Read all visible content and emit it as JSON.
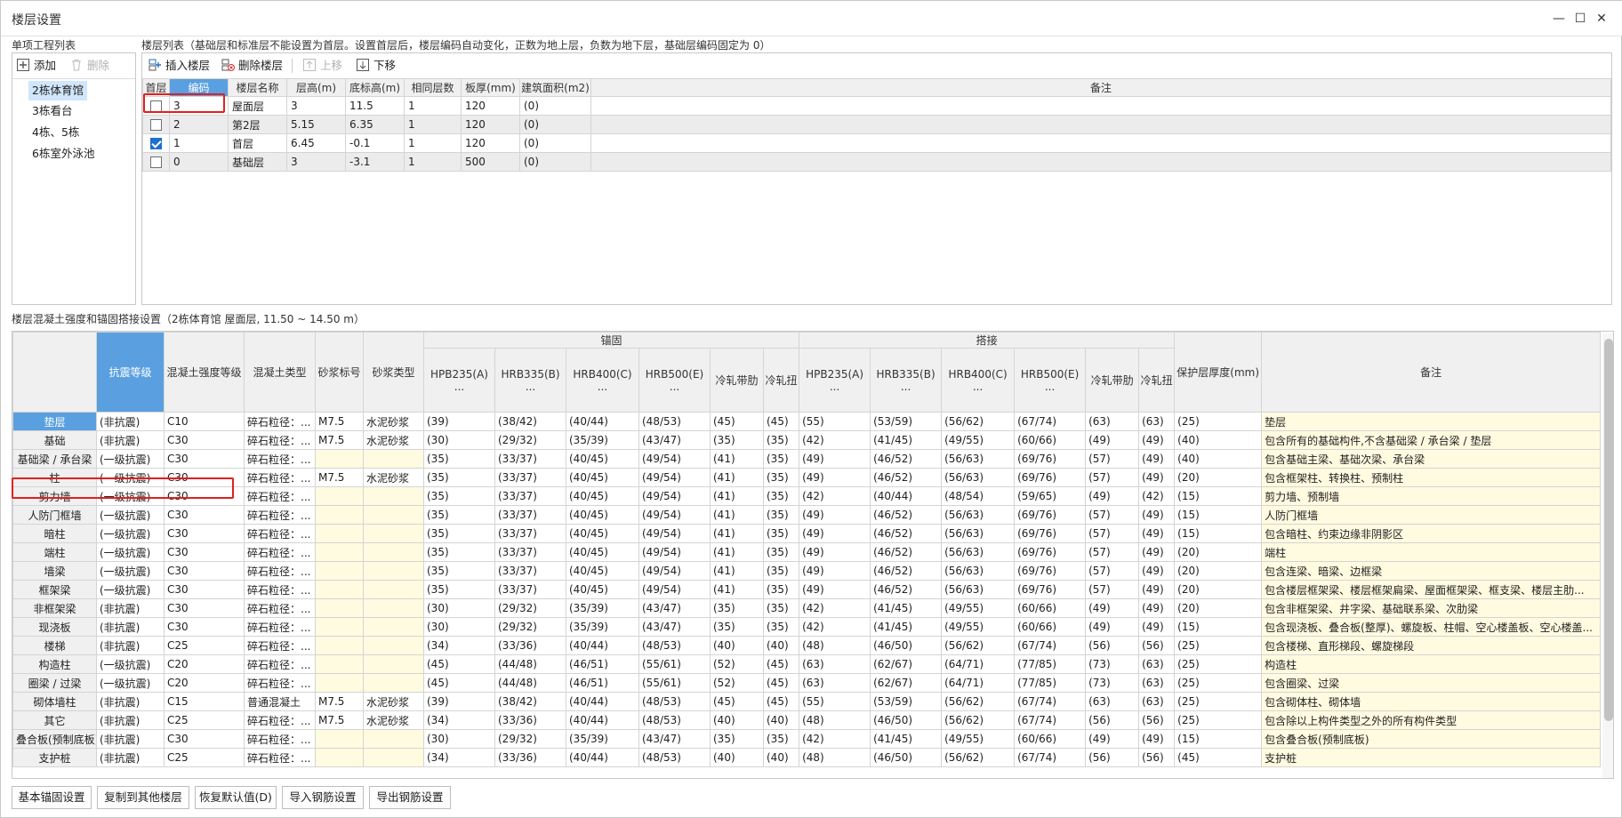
{
  "window": {
    "title": "楼层设置",
    "min": "—",
    "max": "☐",
    "close": "✕"
  },
  "project_list": {
    "label": "单项工程列表",
    "add": "添加",
    "delete": "删除",
    "items": [
      "2栋体育馆",
      "3栋看台",
      "4栋、5栋",
      "6栋室外泳池"
    ],
    "selected": 0
  },
  "floor_list": {
    "label": "楼层列表（基础层和标准层不能设置为首层。设置首层后，楼层编码自动变化，正数为地上层，负数为地下层，基础层编码固定为 0）",
    "toolbar": {
      "insert": "插入楼层",
      "delete": "删除楼层",
      "up": "上移",
      "down": "下移"
    },
    "columns": [
      "首层",
      "编码",
      "楼层名称",
      "层高(m)",
      "底标高(m)",
      "相同层数",
      "板厚(mm)",
      "建筑面积(m2)",
      "备注"
    ],
    "rows": [
      {
        "first": false,
        "code": "3",
        "name": "屋面层",
        "height": "3",
        "bottom": "11.5",
        "same": "1",
        "thick": "120",
        "area": "(0)",
        "note": ""
      },
      {
        "first": false,
        "code": "2",
        "name": "第2层",
        "height": "5.15",
        "bottom": "6.35",
        "same": "1",
        "thick": "120",
        "area": "(0)",
        "note": ""
      },
      {
        "first": true,
        "code": "1",
        "name": "首层",
        "height": "6.45",
        "bottom": "-0.1",
        "same": "1",
        "thick": "120",
        "area": "(0)",
        "note": ""
      },
      {
        "first": false,
        "code": "0",
        "name": "基础层",
        "height": "3",
        "bottom": "-3.1",
        "same": "1",
        "thick": "500",
        "area": "(0)",
        "note": ""
      }
    ]
  },
  "settings": {
    "label": "楼层混凝土强度和锚固搭接设置（2栋体育馆  屋面层, 11.50 ~ 14.50 m）",
    "group_anchor": "锚固",
    "group_lap": "搭接",
    "columns": [
      "抗震等级",
      "混凝土强度等级",
      "混凝土类型",
      "砂浆标号",
      "砂浆类型",
      "HPB235(A)\n...",
      "HRB335(B)\n...",
      "HRB400(C)\n...",
      "HRB500(E)\n...",
      "冷轧带肋",
      "冷轧扭",
      "HPB235(A)\n...",
      "HRB335(B)\n...",
      "HRB400(C)\n...",
      "HRB500(E)\n...",
      "冷轧带肋",
      "冷轧扭",
      "保护层厚度(mm)",
      "备注"
    ],
    "rows": [
      [
        "垫层",
        "(非抗震)",
        "C10",
        "碎石粒径：...",
        "M7.5",
        "水泥砂浆",
        "(39)",
        "(38/42)",
        "(40/44)",
        "(48/53)",
        "(45)",
        "(45)",
        "(55)",
        "(53/59)",
        "(56/62)",
        "(67/74)",
        "(63)",
        "(63)",
        "(25)",
        "垫层"
      ],
      [
        "基础",
        "(非抗震)",
        "C30",
        "碎石粒径：...",
        "M7.5",
        "水泥砂浆",
        "(30)",
        "(29/32)",
        "(35/39)",
        "(43/47)",
        "(35)",
        "(35)",
        "(42)",
        "(41/45)",
        "(49/55)",
        "(60/66)",
        "(49)",
        "(49)",
        "(40)",
        "包含所有的基础构件,不含基础梁 / 承台梁 / 垫层"
      ],
      [
        "基础梁 / 承台梁",
        "(一级抗震)",
        "C30",
        "碎石粒径：...",
        "",
        "",
        "(35)",
        "(33/37)",
        "(40/45)",
        "(49/54)",
        "(41)",
        "(35)",
        "(49)",
        "(46/52)",
        "(56/63)",
        "(69/76)",
        "(57)",
        "(49)",
        "(40)",
        "包含基础主梁、基础次梁、承台梁"
      ],
      [
        "柱",
        "(一级抗震)",
        "C30",
        "碎石粒径：...",
        "M7.5",
        "水泥砂浆",
        "(35)",
        "(33/37)",
        "(40/45)",
        "(49/54)",
        "(41)",
        "(35)",
        "(49)",
        "(46/52)",
        "(56/63)",
        "(69/76)",
        "(57)",
        "(49)",
        "(20)",
        "包含框架柱、转换柱、预制柱"
      ],
      [
        "剪力墙",
        "(一级抗震)",
        "C30",
        "碎石粒径：...",
        "",
        "",
        "(35)",
        "(33/37)",
        "(40/45)",
        "(49/54)",
        "(41)",
        "(35)",
        "(42)",
        "(40/44)",
        "(48/54)",
        "(59/65)",
        "(49)",
        "(42)",
        "(15)",
        "剪力墙、预制墙"
      ],
      [
        "人防门框墙",
        "(一级抗震)",
        "C30",
        "碎石粒径：...",
        "",
        "",
        "(35)",
        "(33/37)",
        "(40/45)",
        "(49/54)",
        "(41)",
        "(35)",
        "(49)",
        "(46/52)",
        "(56/63)",
        "(69/76)",
        "(57)",
        "(49)",
        "(15)",
        "人防门框墙"
      ],
      [
        "暗柱",
        "(一级抗震)",
        "C30",
        "碎石粒径：...",
        "",
        "",
        "(35)",
        "(33/37)",
        "(40/45)",
        "(49/54)",
        "(41)",
        "(35)",
        "(49)",
        "(46/52)",
        "(56/63)",
        "(69/76)",
        "(57)",
        "(49)",
        "(15)",
        "包含暗柱、约束边缘非阴影区"
      ],
      [
        "端柱",
        "(一级抗震)",
        "C30",
        "碎石粒径：...",
        "",
        "",
        "(35)",
        "(33/37)",
        "(40/45)",
        "(49/54)",
        "(41)",
        "(35)",
        "(49)",
        "(46/52)",
        "(56/63)",
        "(69/76)",
        "(57)",
        "(49)",
        "(20)",
        "端柱"
      ],
      [
        "墙梁",
        "(一级抗震)",
        "C30",
        "碎石粒径：...",
        "",
        "",
        "(35)",
        "(33/37)",
        "(40/45)",
        "(49/54)",
        "(41)",
        "(35)",
        "(49)",
        "(46/52)",
        "(56/63)",
        "(69/76)",
        "(57)",
        "(49)",
        "(20)",
        "包含连梁、暗梁、边框梁"
      ],
      [
        "框架梁",
        "(一级抗震)",
        "C30",
        "碎石粒径：...",
        "",
        "",
        "(35)",
        "(33/37)",
        "(40/45)",
        "(49/54)",
        "(41)",
        "(35)",
        "(49)",
        "(46/52)",
        "(56/63)",
        "(69/76)",
        "(57)",
        "(49)",
        "(20)",
        "包含楼层框架梁、楼层框架扁梁、屋面框架梁、框支梁、楼层主肋..."
      ],
      [
        "非框架梁",
        "(非抗震)",
        "C30",
        "碎石粒径：...",
        "",
        "",
        "(30)",
        "(29/32)",
        "(35/39)",
        "(43/47)",
        "(35)",
        "(35)",
        "(42)",
        "(41/45)",
        "(49/55)",
        "(60/66)",
        "(49)",
        "(49)",
        "(20)",
        "包含非框架梁、井字梁、基础联系梁、次肋梁"
      ],
      [
        "现浇板",
        "(非抗震)",
        "C30",
        "碎石粒径：...",
        "",
        "",
        "(30)",
        "(29/32)",
        "(35/39)",
        "(43/47)",
        "(35)",
        "(35)",
        "(42)",
        "(41/45)",
        "(49/55)",
        "(60/66)",
        "(49)",
        "(49)",
        "(15)",
        "包含现浇板、叠合板(整厚)、螺旋板、柱帽、空心楼盖板、空心楼盖..."
      ],
      [
        "楼梯",
        "(非抗震)",
        "C25",
        "碎石粒径：...",
        "",
        "",
        "(34)",
        "(33/36)",
        "(40/44)",
        "(48/53)",
        "(40)",
        "(40)",
        "(48)",
        "(46/50)",
        "(56/62)",
        "(67/74)",
        "(56)",
        "(56)",
        "(25)",
        "包含楼梯、直形梯段、螺旋梯段"
      ],
      [
        "构造柱",
        "(一级抗震)",
        "C20",
        "碎石粒径：...",
        "",
        "",
        "(45)",
        "(44/48)",
        "(46/51)",
        "(55/61)",
        "(52)",
        "(45)",
        "(63)",
        "(62/67)",
        "(64/71)",
        "(77/85)",
        "(73)",
        "(63)",
        "(25)",
        "构造柱"
      ],
      [
        "圈梁 / 过梁",
        "(一级抗震)",
        "C20",
        "碎石粒径：...",
        "",
        "",
        "(45)",
        "(44/48)",
        "(46/51)",
        "(55/61)",
        "(52)",
        "(45)",
        "(63)",
        "(62/67)",
        "(64/71)",
        "(77/85)",
        "(73)",
        "(63)",
        "(25)",
        "包含圈梁、过梁"
      ],
      [
        "砌体墙柱",
        "(非抗震)",
        "C15",
        "普通混凝土",
        "M7.5",
        "水泥砂浆",
        "(39)",
        "(38/42)",
        "(40/44)",
        "(48/53)",
        "(45)",
        "(45)",
        "(55)",
        "(53/59)",
        "(56/62)",
        "(67/74)",
        "(63)",
        "(63)",
        "(25)",
        "包含砌体柱、砌体墙"
      ],
      [
        "其它",
        "(非抗震)",
        "C25",
        "碎石粒径：...",
        "M7.5",
        "水泥砂浆",
        "(34)",
        "(33/36)",
        "(40/44)",
        "(48/53)",
        "(40)",
        "(40)",
        "(48)",
        "(46/50)",
        "(56/62)",
        "(67/74)",
        "(56)",
        "(56)",
        "(25)",
        "包含除以上构件类型之外的所有构件类型"
      ],
      [
        "叠合板(预制底板)",
        "(非抗震)",
        "C30",
        "碎石粒径：...",
        "",
        "",
        "(30)",
        "(29/32)",
        "(35/39)",
        "(43/47)",
        "(35)",
        "(35)",
        "(42)",
        "(41/45)",
        "(49/55)",
        "(60/66)",
        "(49)",
        "(49)",
        "(15)",
        "包含叠合板(预制底板)"
      ],
      [
        "支护桩",
        "(非抗震)",
        "C25",
        "碎石粒径：...",
        "",
        "",
        "(34)",
        "(33/36)",
        "(40/44)",
        "(48/53)",
        "(40)",
        "(40)",
        "(48)",
        "(46/50)",
        "(56/62)",
        "(67/74)",
        "(56)",
        "(56)",
        "(45)",
        "支护桩"
      ]
    ]
  },
  "buttons": [
    "基本锚固设置",
    "复制到其他楼层",
    "恢复默认值(D)",
    "导入钢筋设置",
    "导出钢筋设置"
  ]
}
